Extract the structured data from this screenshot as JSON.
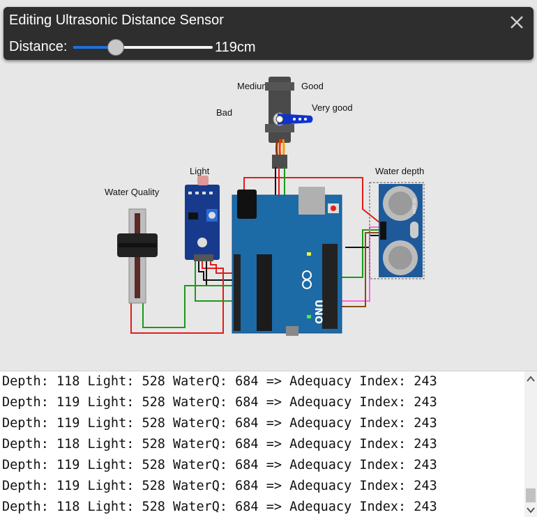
{
  "editor": {
    "title": "Editing Ultrasonic Distance Sensor",
    "distance_label": "Distance:",
    "distance_value": "119cm",
    "distance_fraction": 0.3,
    "close_icon": "close-icon"
  },
  "labels": {
    "medium": "Medium",
    "good": "Good",
    "bad": "Bad",
    "very_good": "Very good",
    "light": "Light",
    "water_quality": "Water Quality",
    "water_depth": "Water depth"
  },
  "components": {
    "arduino": {
      "brand": "UNO",
      "color": "#1c6aa6"
    },
    "ultrasonic": {
      "model": "HC-SR04",
      "color": "#1e5a9a"
    },
    "servo_horn_color": "#1133cc"
  },
  "serial": {
    "lines": [
      "Depth: 118 Light: 528 WaterQ: 684 => Adequacy Index: 243",
      "Depth: 119 Light: 528 WaterQ: 684 => Adequacy Index: 243",
      "Depth: 119 Light: 528 WaterQ: 684 => Adequacy Index: 243",
      "Depth: 118 Light: 528 WaterQ: 684 => Adequacy Index: 243",
      "Depth: 119 Light: 528 WaterQ: 684 => Adequacy Index: 243",
      "Depth: 119 Light: 528 WaterQ: 684 => Adequacy Index: 243",
      "Depth: 118 Light: 528 WaterQ: 684 => Adequacy Index: 243"
    ]
  }
}
